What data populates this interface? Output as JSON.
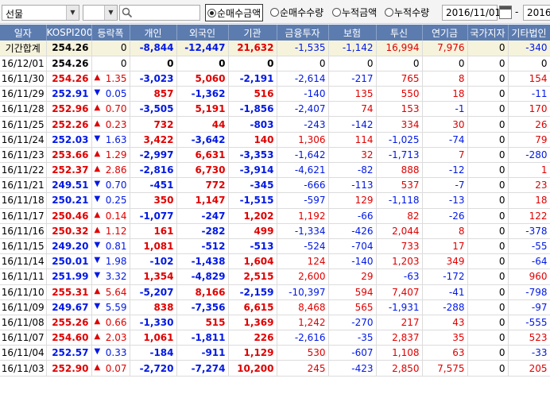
{
  "toolbar": {
    "market_select": "선물",
    "second_select": "",
    "search_value": "",
    "radios": [
      {
        "label": "순매수금액",
        "selected": true
      },
      {
        "label": "순매수수량",
        "selected": false
      },
      {
        "label": "누적금액",
        "selected": false
      },
      {
        "label": "누적수량",
        "selected": false
      }
    ],
    "start_date": "2016/11/01",
    "date_separator": "-",
    "end_date": "2016/"
  },
  "colors": {
    "header_bg": "#5c7cb0",
    "up": "#e00000",
    "down": "#0018e6"
  },
  "headers": [
    "일자",
    "KOSPI200",
    "등락폭",
    "개인",
    "외국인",
    "기관",
    "금융투자",
    "보험",
    "투신",
    "연기금",
    "국가지자",
    "기타법인"
  ],
  "rows": [
    {
      "date": "기간합계",
      "kospi": "254.26",
      "kdir": "none",
      "dir": "none",
      "chg": "0",
      "v": [
        "-8,844",
        "-12,447",
        "21,632",
        "-1,535",
        "-1,142",
        "16,994",
        "7,976",
        "0",
        "-340"
      ]
    },
    {
      "date": "16/12/01",
      "kospi": "254.26",
      "kdir": "none",
      "dir": "none",
      "chg": "0",
      "v": [
        "0",
        "0",
        "0",
        "0",
        "0",
        "0",
        "0",
        "0",
        "0"
      ]
    },
    {
      "date": "16/11/30",
      "kospi": "254.26",
      "kdir": "up",
      "dir": "up",
      "chg": "1.35",
      "v": [
        "-3,023",
        "5,060",
        "-2,191",
        "-2,614",
        "-217",
        "765",
        "8",
        "0",
        "154"
      ]
    },
    {
      "date": "16/11/29",
      "kospi": "252.91",
      "kdir": "down",
      "dir": "down",
      "chg": "0.05",
      "v": [
        "857",
        "-1,362",
        "516",
        "-140",
        "135",
        "550",
        "18",
        "0",
        "-11"
      ]
    },
    {
      "date": "16/11/28",
      "kospi": "252.96",
      "kdir": "up",
      "dir": "up",
      "chg": "0.70",
      "v": [
        "-3,505",
        "5,191",
        "-1,856",
        "-2,407",
        "74",
        "153",
        "-1",
        "0",
        "170"
      ]
    },
    {
      "date": "16/11/25",
      "kospi": "252.26",
      "kdir": "up",
      "dir": "up",
      "chg": "0.23",
      "v": [
        "732",
        "44",
        "-803",
        "-243",
        "-142",
        "334",
        "30",
        "0",
        "26"
      ]
    },
    {
      "date": "16/11/24",
      "kospi": "252.03",
      "kdir": "down",
      "dir": "down",
      "chg": "1.63",
      "v": [
        "3,422",
        "-3,642",
        "140",
        "1,306",
        "114",
        "-1,025",
        "-74",
        "0",
        "79"
      ]
    },
    {
      "date": "16/11/23",
      "kospi": "253.66",
      "kdir": "up",
      "dir": "up",
      "chg": "1.29",
      "v": [
        "-2,997",
        "6,631",
        "-3,353",
        "-1,642",
        "32",
        "-1,713",
        "7",
        "0",
        "-280"
      ]
    },
    {
      "date": "16/11/22",
      "kospi": "252.37",
      "kdir": "up",
      "dir": "up",
      "chg": "2.86",
      "v": [
        "-2,816",
        "6,730",
        "-3,914",
        "-4,621",
        "-82",
        "888",
        "-12",
        "0",
        "1"
      ]
    },
    {
      "date": "16/11/21",
      "kospi": "249.51",
      "kdir": "down",
      "dir": "down",
      "chg": "0.70",
      "v": [
        "-451",
        "772",
        "-345",
        "-666",
        "-113",
        "537",
        "-7",
        "0",
        "23"
      ]
    },
    {
      "date": "16/11/18",
      "kospi": "250.21",
      "kdir": "down",
      "dir": "down",
      "chg": "0.25",
      "v": [
        "350",
        "1,147",
        "-1,515",
        "-597",
        "129",
        "-1,118",
        "-13",
        "0",
        "18"
      ]
    },
    {
      "date": "16/11/17",
      "kospi": "250.46",
      "kdir": "up",
      "dir": "up",
      "chg": "0.14",
      "v": [
        "-1,077",
        "-247",
        "1,202",
        "1,192",
        "-66",
        "82",
        "-26",
        "0",
        "122"
      ]
    },
    {
      "date": "16/11/16",
      "kospi": "250.32",
      "kdir": "up",
      "dir": "up",
      "chg": "1.12",
      "v": [
        "161",
        "-282",
        "499",
        "-1,334",
        "-426",
        "2,044",
        "8",
        "0",
        "-378"
      ]
    },
    {
      "date": "16/11/15",
      "kospi": "249.20",
      "kdir": "down",
      "dir": "down",
      "chg": "0.81",
      "v": [
        "1,081",
        "-512",
        "-513",
        "-524",
        "-704",
        "733",
        "17",
        "0",
        "-55"
      ]
    },
    {
      "date": "16/11/14",
      "kospi": "250.01",
      "kdir": "down",
      "dir": "down",
      "chg": "1.98",
      "v": [
        "-102",
        "-1,438",
        "1,604",
        "124",
        "-140",
        "1,203",
        "349",
        "0",
        "-64"
      ]
    },
    {
      "date": "16/11/11",
      "kospi": "251.99",
      "kdir": "down",
      "dir": "down",
      "chg": "3.32",
      "v": [
        "1,354",
        "-4,829",
        "2,515",
        "2,600",
        "29",
        "-63",
        "-172",
        "0",
        "960"
      ]
    },
    {
      "date": "16/11/10",
      "kospi": "255.31",
      "kdir": "up",
      "dir": "up",
      "chg": "5.64",
      "v": [
        "-5,207",
        "8,166",
        "-2,159",
        "-10,397",
        "594",
        "7,407",
        "-41",
        "0",
        "-798"
      ]
    },
    {
      "date": "16/11/09",
      "kospi": "249.67",
      "kdir": "down",
      "dir": "down",
      "chg": "5.59",
      "v": [
        "838",
        "-7,356",
        "6,615",
        "8,468",
        "565",
        "-1,931",
        "-288",
        "0",
        "-97"
      ]
    },
    {
      "date": "16/11/08",
      "kospi": "255.26",
      "kdir": "up",
      "dir": "up",
      "chg": "0.66",
      "v": [
        "-1,330",
        "515",
        "1,369",
        "1,242",
        "-270",
        "217",
        "43",
        "0",
        "-555"
      ]
    },
    {
      "date": "16/11/07",
      "kospi": "254.60",
      "kdir": "up",
      "dir": "up",
      "chg": "2.03",
      "v": [
        "1,061",
        "-1,811",
        "226",
        "-2,616",
        "-35",
        "2,837",
        "35",
        "0",
        "523"
      ]
    },
    {
      "date": "16/11/04",
      "kospi": "252.57",
      "kdir": "down",
      "dir": "down",
      "chg": "0.33",
      "v": [
        "-184",
        "-911",
        "1,129",
        "530",
        "-607",
        "1,108",
        "63",
        "0",
        "-33"
      ]
    },
    {
      "date": "16/11/03",
      "kospi": "252.90",
      "kdir": "up",
      "dir": "up",
      "chg": "0.07",
      "v": [
        "-2,720",
        "-7,274",
        "10,200",
        "245",
        "-423",
        "2,850",
        "7,575",
        "0",
        "205"
      ]
    }
  ]
}
